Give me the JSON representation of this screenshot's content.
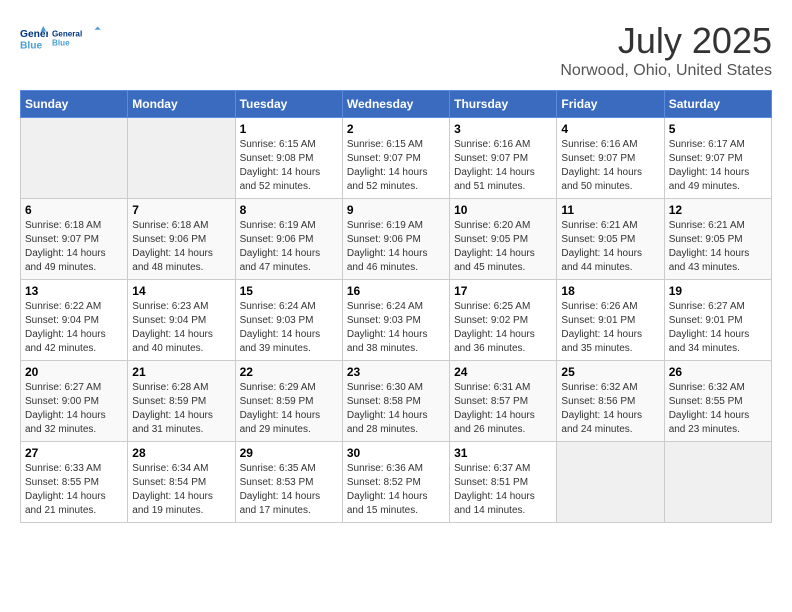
{
  "header": {
    "logo_line1": "General",
    "logo_line2": "Blue",
    "month_year": "July 2025",
    "location": "Norwood, Ohio, United States"
  },
  "days_of_week": [
    "Sunday",
    "Monday",
    "Tuesday",
    "Wednesday",
    "Thursday",
    "Friday",
    "Saturday"
  ],
  "weeks": [
    [
      {
        "day": "",
        "sunrise": "",
        "sunset": "",
        "daylight": ""
      },
      {
        "day": "",
        "sunrise": "",
        "sunset": "",
        "daylight": ""
      },
      {
        "day": "1",
        "sunrise": "Sunrise: 6:15 AM",
        "sunset": "Sunset: 9:08 PM",
        "daylight": "Daylight: 14 hours and 52 minutes."
      },
      {
        "day": "2",
        "sunrise": "Sunrise: 6:15 AM",
        "sunset": "Sunset: 9:07 PM",
        "daylight": "Daylight: 14 hours and 52 minutes."
      },
      {
        "day": "3",
        "sunrise": "Sunrise: 6:16 AM",
        "sunset": "Sunset: 9:07 PM",
        "daylight": "Daylight: 14 hours and 51 minutes."
      },
      {
        "day": "4",
        "sunrise": "Sunrise: 6:16 AM",
        "sunset": "Sunset: 9:07 PM",
        "daylight": "Daylight: 14 hours and 50 minutes."
      },
      {
        "day": "5",
        "sunrise": "Sunrise: 6:17 AM",
        "sunset": "Sunset: 9:07 PM",
        "daylight": "Daylight: 14 hours and 49 minutes."
      }
    ],
    [
      {
        "day": "6",
        "sunrise": "Sunrise: 6:18 AM",
        "sunset": "Sunset: 9:07 PM",
        "daylight": "Daylight: 14 hours and 49 minutes."
      },
      {
        "day": "7",
        "sunrise": "Sunrise: 6:18 AM",
        "sunset": "Sunset: 9:06 PM",
        "daylight": "Daylight: 14 hours and 48 minutes."
      },
      {
        "day": "8",
        "sunrise": "Sunrise: 6:19 AM",
        "sunset": "Sunset: 9:06 PM",
        "daylight": "Daylight: 14 hours and 47 minutes."
      },
      {
        "day": "9",
        "sunrise": "Sunrise: 6:19 AM",
        "sunset": "Sunset: 9:06 PM",
        "daylight": "Daylight: 14 hours and 46 minutes."
      },
      {
        "day": "10",
        "sunrise": "Sunrise: 6:20 AM",
        "sunset": "Sunset: 9:05 PM",
        "daylight": "Daylight: 14 hours and 45 minutes."
      },
      {
        "day": "11",
        "sunrise": "Sunrise: 6:21 AM",
        "sunset": "Sunset: 9:05 PM",
        "daylight": "Daylight: 14 hours and 44 minutes."
      },
      {
        "day": "12",
        "sunrise": "Sunrise: 6:21 AM",
        "sunset": "Sunset: 9:05 PM",
        "daylight": "Daylight: 14 hours and 43 minutes."
      }
    ],
    [
      {
        "day": "13",
        "sunrise": "Sunrise: 6:22 AM",
        "sunset": "Sunset: 9:04 PM",
        "daylight": "Daylight: 14 hours and 42 minutes."
      },
      {
        "day": "14",
        "sunrise": "Sunrise: 6:23 AM",
        "sunset": "Sunset: 9:04 PM",
        "daylight": "Daylight: 14 hours and 40 minutes."
      },
      {
        "day": "15",
        "sunrise": "Sunrise: 6:24 AM",
        "sunset": "Sunset: 9:03 PM",
        "daylight": "Daylight: 14 hours and 39 minutes."
      },
      {
        "day": "16",
        "sunrise": "Sunrise: 6:24 AM",
        "sunset": "Sunset: 9:03 PM",
        "daylight": "Daylight: 14 hours and 38 minutes."
      },
      {
        "day": "17",
        "sunrise": "Sunrise: 6:25 AM",
        "sunset": "Sunset: 9:02 PM",
        "daylight": "Daylight: 14 hours and 36 minutes."
      },
      {
        "day": "18",
        "sunrise": "Sunrise: 6:26 AM",
        "sunset": "Sunset: 9:01 PM",
        "daylight": "Daylight: 14 hours and 35 minutes."
      },
      {
        "day": "19",
        "sunrise": "Sunrise: 6:27 AM",
        "sunset": "Sunset: 9:01 PM",
        "daylight": "Daylight: 14 hours and 34 minutes."
      }
    ],
    [
      {
        "day": "20",
        "sunrise": "Sunrise: 6:27 AM",
        "sunset": "Sunset: 9:00 PM",
        "daylight": "Daylight: 14 hours and 32 minutes."
      },
      {
        "day": "21",
        "sunrise": "Sunrise: 6:28 AM",
        "sunset": "Sunset: 8:59 PM",
        "daylight": "Daylight: 14 hours and 31 minutes."
      },
      {
        "day": "22",
        "sunrise": "Sunrise: 6:29 AM",
        "sunset": "Sunset: 8:59 PM",
        "daylight": "Daylight: 14 hours and 29 minutes."
      },
      {
        "day": "23",
        "sunrise": "Sunrise: 6:30 AM",
        "sunset": "Sunset: 8:58 PM",
        "daylight": "Daylight: 14 hours and 28 minutes."
      },
      {
        "day": "24",
        "sunrise": "Sunrise: 6:31 AM",
        "sunset": "Sunset: 8:57 PM",
        "daylight": "Daylight: 14 hours and 26 minutes."
      },
      {
        "day": "25",
        "sunrise": "Sunrise: 6:32 AM",
        "sunset": "Sunset: 8:56 PM",
        "daylight": "Daylight: 14 hours and 24 minutes."
      },
      {
        "day": "26",
        "sunrise": "Sunrise: 6:32 AM",
        "sunset": "Sunset: 8:55 PM",
        "daylight": "Daylight: 14 hours and 23 minutes."
      }
    ],
    [
      {
        "day": "27",
        "sunrise": "Sunrise: 6:33 AM",
        "sunset": "Sunset: 8:55 PM",
        "daylight": "Daylight: 14 hours and 21 minutes."
      },
      {
        "day": "28",
        "sunrise": "Sunrise: 6:34 AM",
        "sunset": "Sunset: 8:54 PM",
        "daylight": "Daylight: 14 hours and 19 minutes."
      },
      {
        "day": "29",
        "sunrise": "Sunrise: 6:35 AM",
        "sunset": "Sunset: 8:53 PM",
        "daylight": "Daylight: 14 hours and 17 minutes."
      },
      {
        "day": "30",
        "sunrise": "Sunrise: 6:36 AM",
        "sunset": "Sunset: 8:52 PM",
        "daylight": "Daylight: 14 hours and 15 minutes."
      },
      {
        "day": "31",
        "sunrise": "Sunrise: 6:37 AM",
        "sunset": "Sunset: 8:51 PM",
        "daylight": "Daylight: 14 hours and 14 minutes."
      },
      {
        "day": "",
        "sunrise": "",
        "sunset": "",
        "daylight": ""
      },
      {
        "day": "",
        "sunrise": "",
        "sunset": "",
        "daylight": ""
      }
    ]
  ]
}
